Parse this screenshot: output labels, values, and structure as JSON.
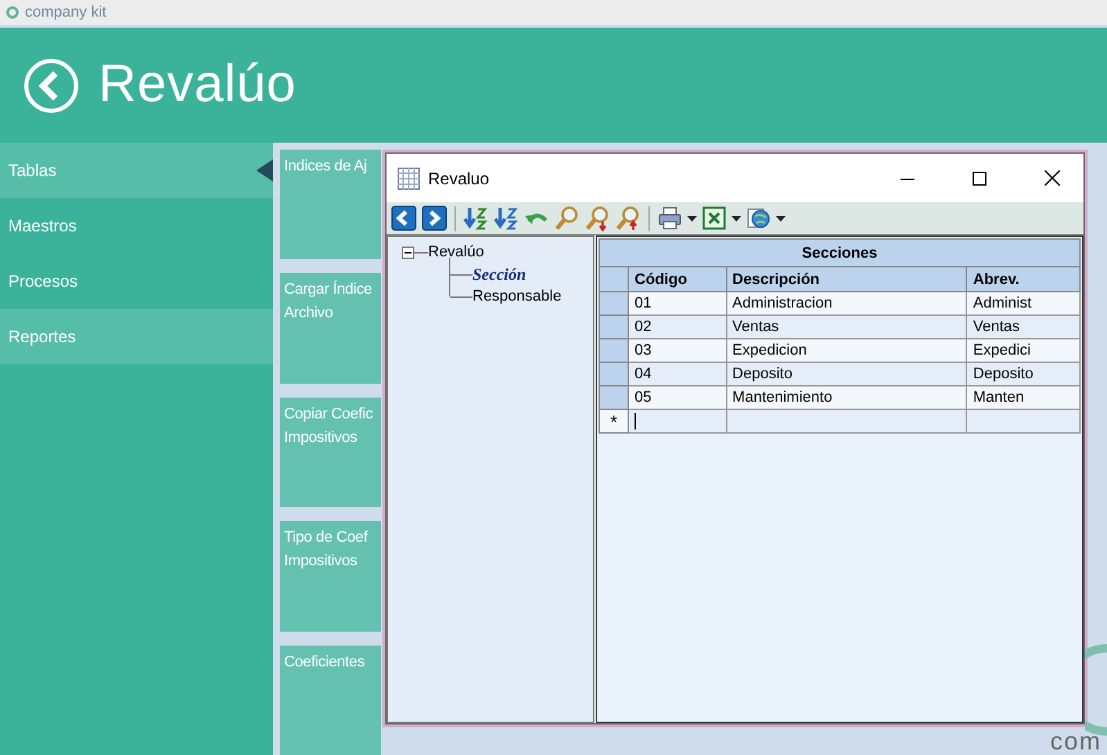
{
  "app_bar": {
    "title": "company kit"
  },
  "header": {
    "title": "Revalúo"
  },
  "sidebar": {
    "items": [
      {
        "label": "Tablas",
        "selected": true,
        "hovered": true
      },
      {
        "label": "Maestros",
        "selected": false,
        "hovered": false
      },
      {
        "label": "Procesos",
        "selected": false,
        "hovered": false
      },
      {
        "label": "Reportes",
        "selected": false,
        "hovered": true
      }
    ]
  },
  "tiles": [
    {
      "lines": [
        "Indices de Aj"
      ]
    },
    {
      "lines": [
        "Cargar Índice",
        "Archivo"
      ]
    },
    {
      "lines": [
        "Copiar Coefic",
        "Impositivos"
      ]
    },
    {
      "lines": [
        "Tipo de Coef",
        "Impositivos"
      ]
    },
    {
      "lines": [
        "Coeficientes"
      ]
    }
  ],
  "dialog": {
    "title": "Revaluo",
    "tree": {
      "label": "Revalúo",
      "expanded": true,
      "children": [
        {
          "label": "Sección",
          "selected": true
        },
        {
          "label": "Responsable",
          "selected": false
        }
      ]
    },
    "grid": {
      "title": "Secciones",
      "columns": [
        "Código",
        "Descripción",
        "Abrev."
      ],
      "rows": [
        {
          "kind": "data",
          "cells": [
            "01",
            "Administracion",
            "Administ"
          ]
        },
        {
          "kind": "data",
          "cells": [
            "02",
            "Ventas",
            "Ventas"
          ]
        },
        {
          "kind": "data",
          "cells": [
            "03",
            "Expedicion",
            "Expedici"
          ]
        },
        {
          "kind": "data",
          "cells": [
            "04",
            "Deposito",
            "Deposito"
          ]
        },
        {
          "kind": "data",
          "cells": [
            "05",
            "Mantenimiento",
            "Manten"
          ]
        },
        {
          "kind": "new",
          "marker": "*"
        }
      ]
    }
  },
  "logo": {
    "text": "com"
  }
}
